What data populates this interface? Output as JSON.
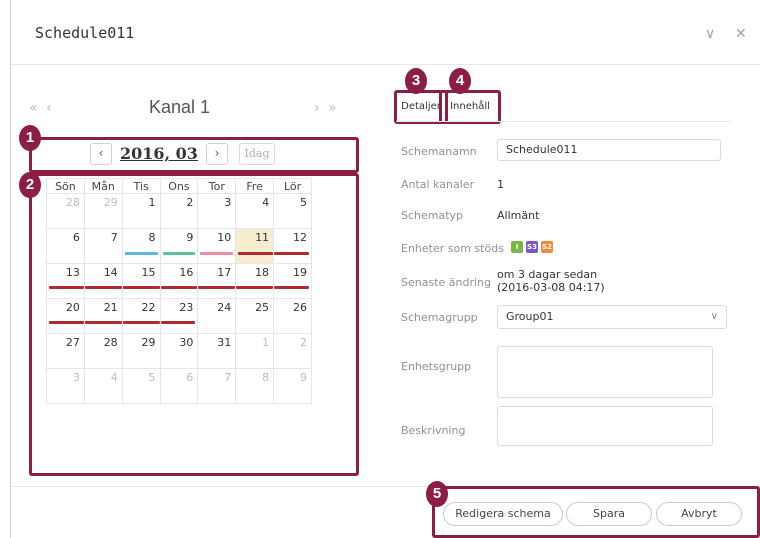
{
  "window": {
    "title": "Schedule011"
  },
  "calendar": {
    "channel": "Kanal 1",
    "nav_prev": "« ‹",
    "nav_next": "› »",
    "month_label": "2016, 03",
    "today_label": "Idag",
    "weekdays": [
      "Sön",
      "Mån",
      "Tis",
      "Ons",
      "Tor",
      "Fre",
      "Lör"
    ],
    "weeks": [
      [
        "28",
        "29",
        "1",
        "2",
        "3",
        "4",
        "5"
      ],
      [
        "6",
        "7",
        "8",
        "9",
        "10",
        "11",
        "12"
      ],
      [
        "13",
        "14",
        "15",
        "16",
        "17",
        "18",
        "19"
      ],
      [
        "20",
        "21",
        "22",
        "23",
        "24",
        "25",
        "26"
      ],
      [
        "27",
        "28",
        "29",
        "30",
        "31",
        "1",
        "2"
      ],
      [
        "3",
        "4",
        "5",
        "6",
        "7",
        "8",
        "9"
      ]
    ],
    "event_colors": {
      "blue": "#5bb8e8",
      "green": "#5cc494",
      "pink": "#f08aa0",
      "red": "#b02a2e"
    }
  },
  "badges": [
    "1",
    "2",
    "3",
    "4",
    "5"
  ],
  "tabs": {
    "details": "Detaljer",
    "content": "Innehåll"
  },
  "details": {
    "name_label": "Schemanamn",
    "name_value": "Schedule011",
    "channels_label": "Antal kanaler",
    "channels_value": "1",
    "type_label": "Schematyp",
    "type_value": "Allmänt",
    "devices_label": "Enheter som stöds",
    "devices": [
      {
        "text": "I",
        "color": "#7ab648"
      },
      {
        "text": "S3",
        "color": "#7a56c8"
      },
      {
        "text": "S2",
        "color": "#f08a3c"
      }
    ],
    "modified_label": "Senaste ändring",
    "modified_line1": "om 3 dagar sedan",
    "modified_line2": "(2016-03-08 04:17)",
    "group_label": "Schemagrupp",
    "group_value": "Group01",
    "unit_group_label": "Enhetsgrupp",
    "description_label": "Beskrivning"
  },
  "footer": {
    "edit": "Redigera schema",
    "save": "Spara",
    "cancel": "Avbryt"
  },
  "accent": "#8c1d45"
}
